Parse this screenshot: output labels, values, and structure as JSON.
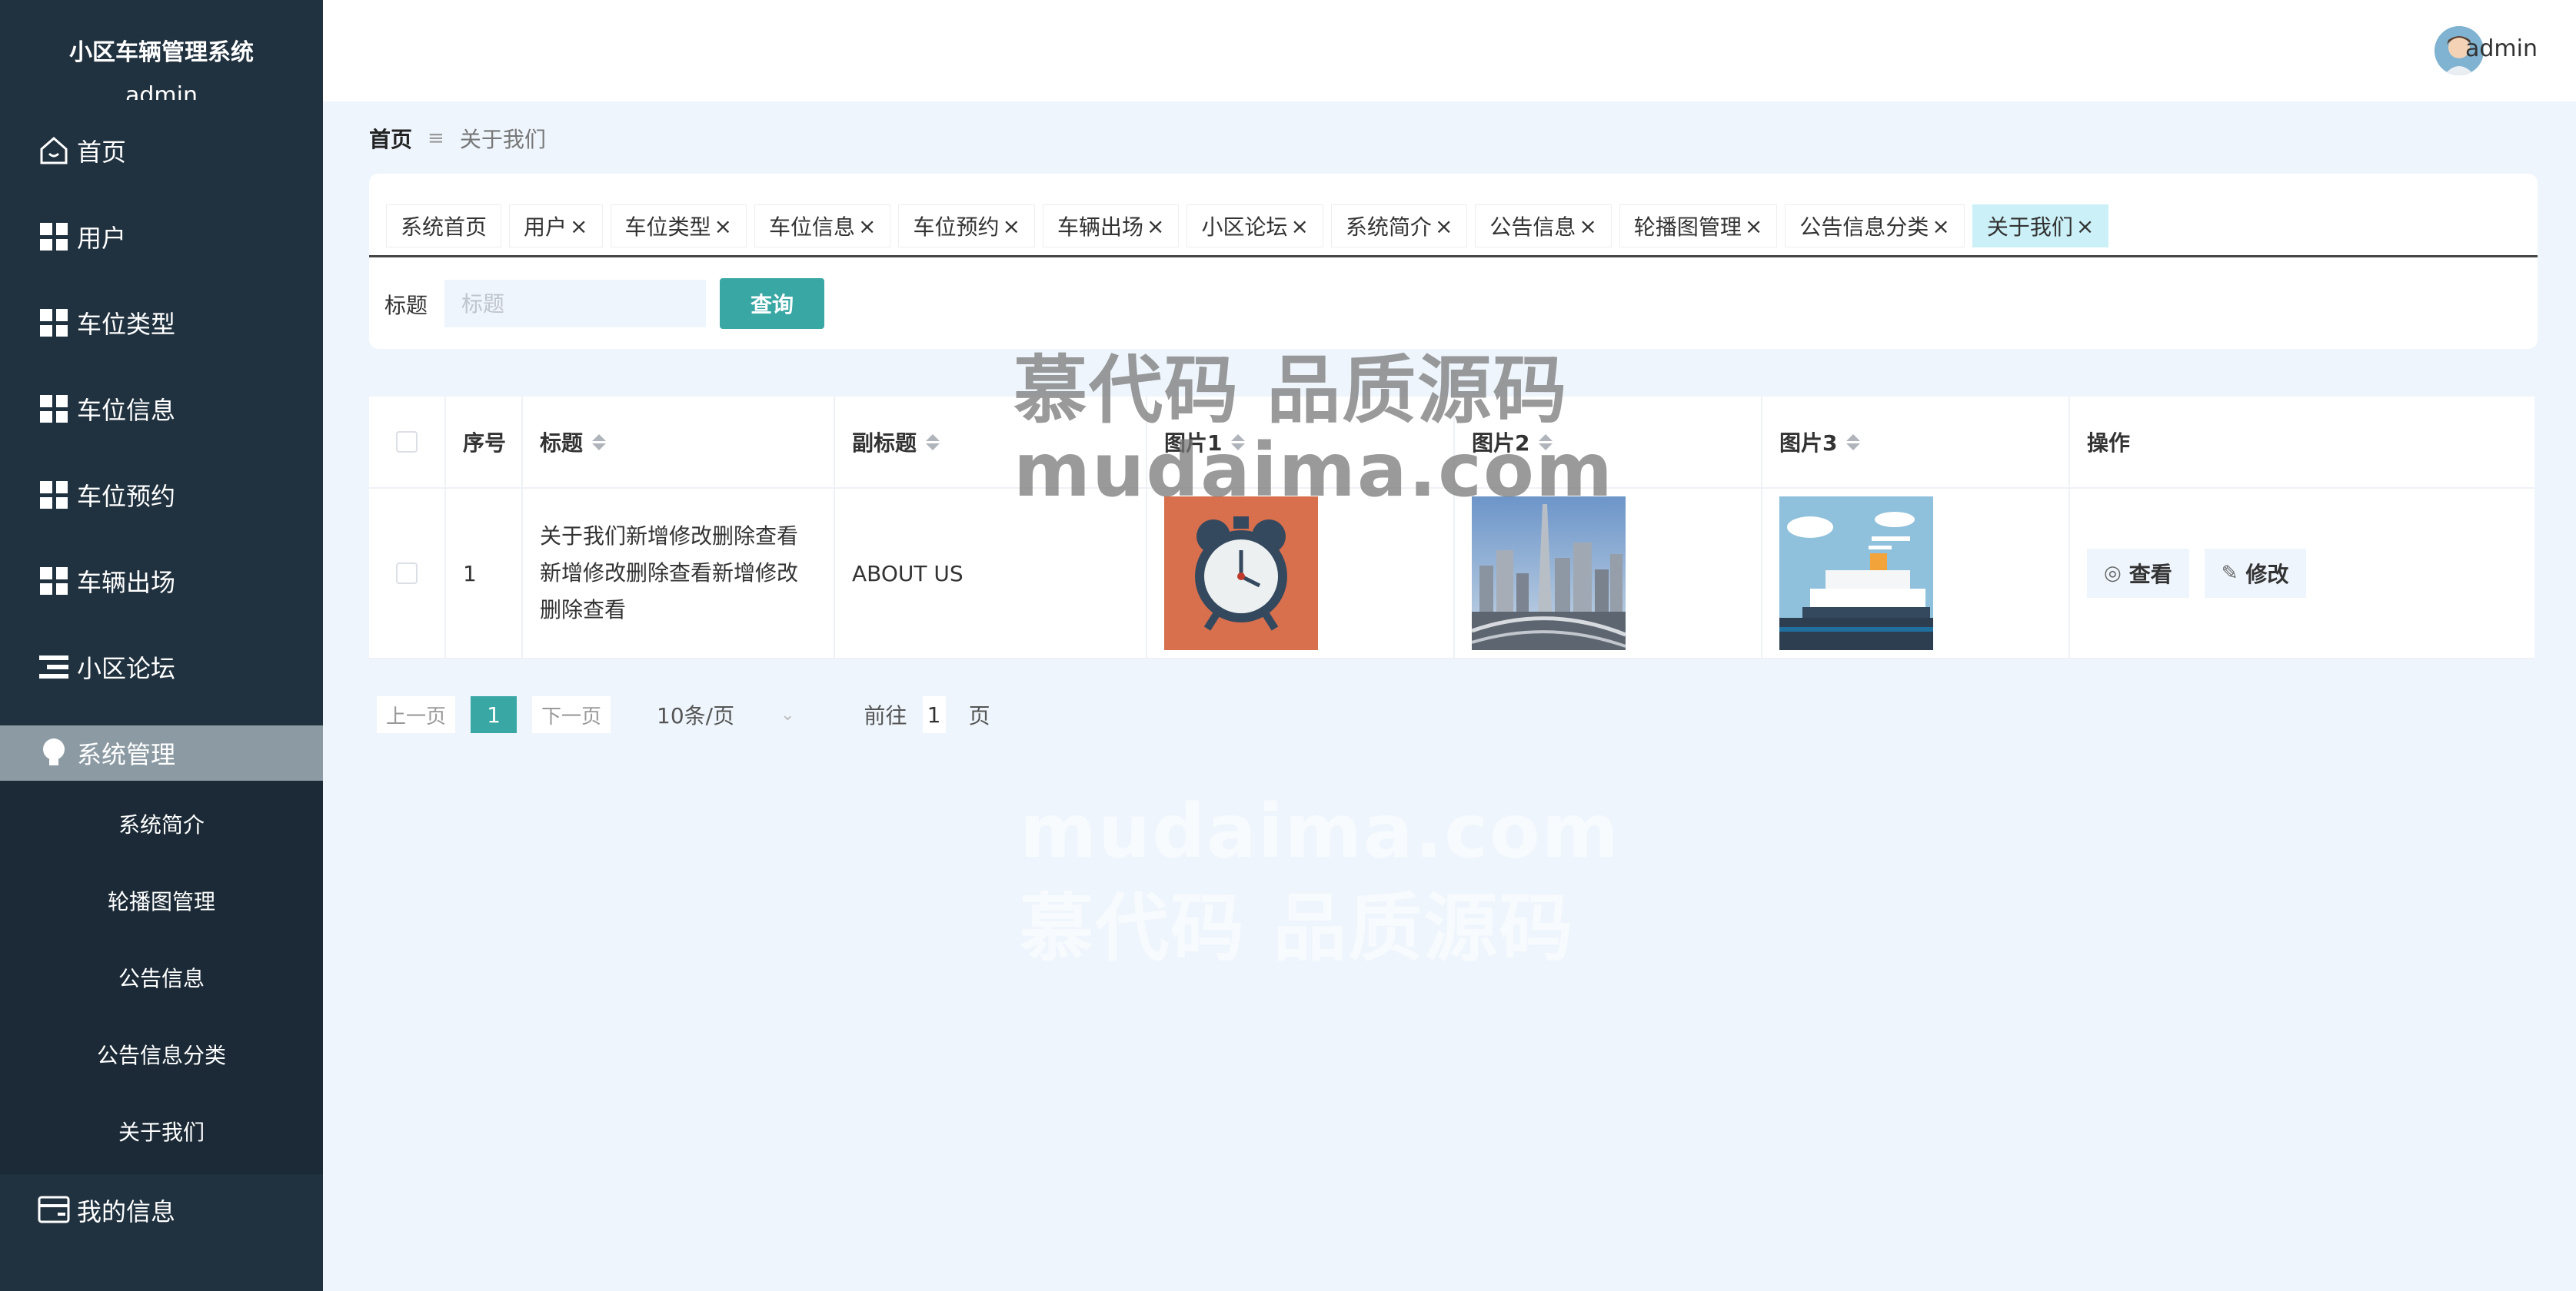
{
  "sidebar": {
    "app_title": "小区车辆管理系统",
    "user_name": "admin",
    "items": [
      {
        "label": "首页",
        "icon": "home-icon"
      },
      {
        "label": "用户",
        "icon": "grid-icon"
      },
      {
        "label": "车位类型",
        "icon": "grid-icon"
      },
      {
        "label": "车位信息",
        "icon": "grid-icon"
      },
      {
        "label": "车位预约",
        "icon": "grid-icon"
      },
      {
        "label": "车辆出场",
        "icon": "grid-icon"
      },
      {
        "label": "小区论坛",
        "icon": "list-icon"
      },
      {
        "label": "系统管理",
        "icon": "bulb-icon"
      }
    ],
    "subitems": [
      {
        "label": "系统简介"
      },
      {
        "label": "轮播图管理"
      },
      {
        "label": "公告信息"
      },
      {
        "label": "公告信息分类"
      },
      {
        "label": "关于我们"
      }
    ],
    "bottom_item": {
      "label": "我的信息",
      "icon": "card-icon"
    }
  },
  "header": {
    "user": "admin"
  },
  "breadcrumb": {
    "home": "首页",
    "separator": "≡",
    "current": "关于我们"
  },
  "tabs": [
    {
      "label": "系统首页",
      "closable": false
    },
    {
      "label": "用户",
      "closable": true
    },
    {
      "label": "车位类型",
      "closable": true
    },
    {
      "label": "车位信息",
      "closable": true
    },
    {
      "label": "车位预约",
      "closable": true
    },
    {
      "label": "车辆出场",
      "closable": true
    },
    {
      "label": "小区论坛",
      "closable": true
    },
    {
      "label": "系统简介",
      "closable": true
    },
    {
      "label": "公告信息",
      "closable": true
    },
    {
      "label": "轮播图管理",
      "closable": true
    },
    {
      "label": "公告信息分类",
      "closable": true
    },
    {
      "label": "关于我们",
      "closable": true
    }
  ],
  "close_glyph": "×",
  "search": {
    "label": "标题",
    "placeholder": "标题",
    "button": "查询"
  },
  "table": {
    "columns": [
      "序号",
      "标题",
      "副标题",
      "图片1",
      "图片2",
      "图片3",
      "操作"
    ],
    "rows": [
      {
        "index": "1",
        "title": "关于我们新增修改删除查看新增修改删除查看新增修改删除查看",
        "subtitle": "ABOUT US",
        "images": [
          "alarm-clock-image",
          "city-skyline-image",
          "ship-image"
        ],
        "actions": {
          "view": "查看",
          "edit": "修改"
        }
      }
    ]
  },
  "pagination": {
    "prev": "上一页",
    "current": "1",
    "next": "下一页",
    "page_size": "10条/页",
    "goto_label": "前往",
    "goto_value": "1",
    "page_suffix": "页"
  },
  "watermark": {
    "line1": "慕代码 品质源码",
    "line2": "mudaima.com"
  },
  "colors": {
    "sidebar_bg": "#20313f",
    "accent": "#39a7a4",
    "active_tab": "#ccf0f7",
    "page_bg": "#eef5fc"
  }
}
